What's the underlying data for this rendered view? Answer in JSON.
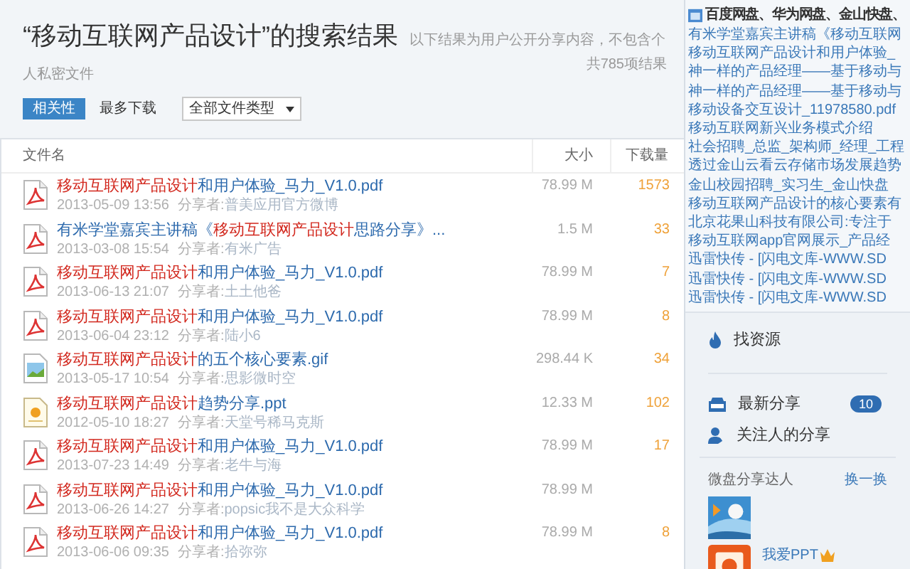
{
  "header": {
    "title": "“移动互联网产品设计”的搜索结果",
    "note_lines": [
      "以下结果为用户公开分享内容，不包含个",
      "人私密文件"
    ],
    "count": "共785项结果"
  },
  "sort": [
    {
      "label": "相关性",
      "selected": true
    },
    {
      "label": "最多下载",
      "selected": false
    }
  ],
  "filter": {
    "value": "全部文件类型"
  },
  "table": {
    "columns": [
      "文件名",
      "大小",
      "下载量"
    ],
    "rows": [
      {
        "kind": "pdf",
        "title_parts": [
          {
            "text": "移动互联网产品设计",
            "highlight": true
          },
          {
            "text": "和用户体验_马力_V1.0.pdf",
            "highlight": false
          }
        ],
        "date": "2013-05-09 13:56",
        "sharer_label": "分享者:",
        "sharer": "普美应用官方微博",
        "size": "78.99 M",
        "downloads": "1573"
      },
      {
        "kind": "pdf",
        "title_parts": [
          {
            "text": "有米学堂嘉宾主讲稿《",
            "highlight": false
          },
          {
            "text": "移动互联网产品设计",
            "highlight": true
          },
          {
            "text": "思路分享》...",
            "highlight": false
          }
        ],
        "date": "2013-03-08 15:54",
        "sharer_label": "分享者:",
        "sharer": "有米广告",
        "size": "1.5 M",
        "downloads": "33"
      },
      {
        "kind": "pdf",
        "title_parts": [
          {
            "text": "移动互联网产品设计",
            "highlight": true
          },
          {
            "text": "和用户体验_马力_V1.0.pdf",
            "highlight": false
          }
        ],
        "date": "2013-06-13 21:07",
        "sharer_label": "分享者:",
        "sharer": "土土他爸",
        "size": "78.99 M",
        "downloads": "7"
      },
      {
        "kind": "pdf",
        "title_parts": [
          {
            "text": "移动互联网产品设计",
            "highlight": true
          },
          {
            "text": "和用户体验_马力_V1.0.pdf",
            "highlight": false
          }
        ],
        "date": "2013-06-04 23:12",
        "sharer_label": "分享者:",
        "sharer": "陆小6",
        "size": "78.99 M",
        "downloads": "8"
      },
      {
        "kind": "gif",
        "title_parts": [
          {
            "text": "移动互联网产品设计",
            "highlight": true
          },
          {
            "text": "的五个核心要素.gif",
            "highlight": false
          }
        ],
        "date": "2013-05-17 10:54",
        "sharer_label": "分享者:",
        "sharer": "思影微时空",
        "size": "298.44 K",
        "downloads": "34"
      },
      {
        "kind": "ppt",
        "title_parts": [
          {
            "text": "移动互联网产品设计",
            "highlight": true
          },
          {
            "text": "趋势分享.ppt",
            "highlight": false
          }
        ],
        "date": "2012-05-10 18:27",
        "sharer_label": "分享者:",
        "sharer": "天堂号稀马克斯",
        "size": "12.33 M",
        "downloads": "102"
      },
      {
        "kind": "pdf",
        "title_parts": [
          {
            "text": "移动互联网产品设计",
            "highlight": true
          },
          {
            "text": "和用户体验_马力_V1.0.pdf",
            "highlight": false
          }
        ],
        "date": "2013-07-23 14:49",
        "sharer_label": "分享者:",
        "sharer": "老牛与海",
        "size": "78.99 M",
        "downloads": "17"
      },
      {
        "kind": "pdf",
        "title_parts": [
          {
            "text": "移动互联网产品设计",
            "highlight": true
          },
          {
            "text": "和用户体验_马力_V1.0.pdf",
            "highlight": false
          }
        ],
        "date": "2013-06-26 14:27",
        "sharer_label": "分享者:",
        "sharer": "popsic我不是大众科学",
        "size": "78.99 M"
      },
      {
        "kind": "pdf",
        "title_parts": [
          {
            "text": "移动互联网产品设计",
            "highlight": true
          },
          {
            "text": "和用户体验_马力_V1.0.pdf",
            "highlight": false
          }
        ],
        "date": "2013-06-06 09:35",
        "sharer_label": "分享者:",
        "sharer": "拾弥弥",
        "size": "78.99 M",
        "downloads": "8"
      }
    ]
  },
  "sidebar": {
    "heading": "百度网盘、华为网盘、金山快盘、",
    "links": [
      "有米学堂嘉宾主讲稿《移动互联网",
      "移动互联网产品设计和用户体验_",
      "神一样的产品经理——基于移动与",
      "神一样的产品经理——基于移动与",
      "移动设备交互设计_11978580.pdf",
      "移动互联网新兴业务模式介绍",
      "社会招聘_总监_架构师_经理_工程",
      "透过金山云看云存储市场发展趋势",
      "金山校园招聘_实习生_金山快盘",
      "移动互联网产品设计的核心要素有",
      "北京花果山科技有限公司:专注于",
      "移动互联网app官网展示_产品经",
      "迅雷快传 - [闪电文库-WWW.SD",
      "迅雷快传 - [闪电文库-WWW.SD",
      "迅雷快传 - [闪电文库-WWW.SD"
    ],
    "nav": [
      {
        "kind": "find",
        "label": "找资源"
      },
      {
        "kind": "latest",
        "label": "最新分享",
        "badge": "10"
      },
      {
        "kind": "follow",
        "label": "关注人的分享"
      }
    ],
    "experts_title": "微盘分享达人",
    "shuffle": "换一换",
    "experts": [
      {
        "kind": "picture"
      },
      {
        "kind": "ppt",
        "name": "我爱PPT",
        "crown": true
      }
    ]
  }
}
